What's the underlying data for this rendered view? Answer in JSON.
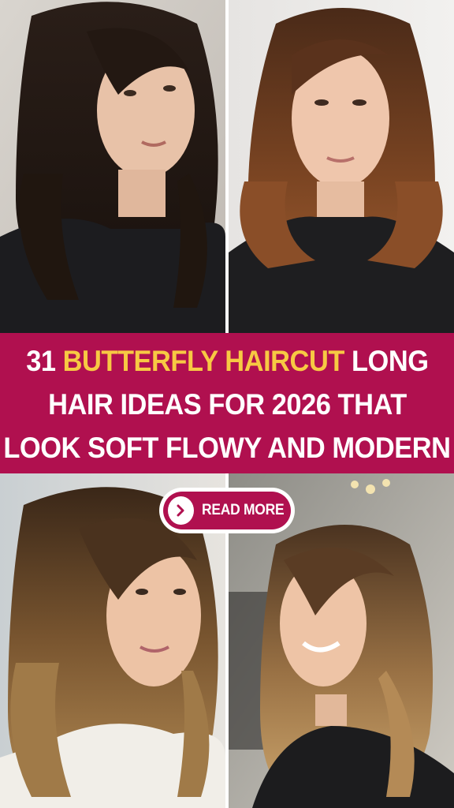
{
  "banner": {
    "line1_prefix": "31 ",
    "line1_highlight": "BUTTERFLY HAIRCUT",
    "line1_suffix": " LONG",
    "line2": "HAIR IDEAS FOR 2026 THAT",
    "line3": "LOOK SOFT FLOWY AND MODERN"
  },
  "cta": {
    "label": "READ MORE",
    "icon": "chevron-right-icon"
  },
  "colors": {
    "banner_bg": "#b0104f",
    "highlight": "#f7c943",
    "text": "#ffffff"
  }
}
